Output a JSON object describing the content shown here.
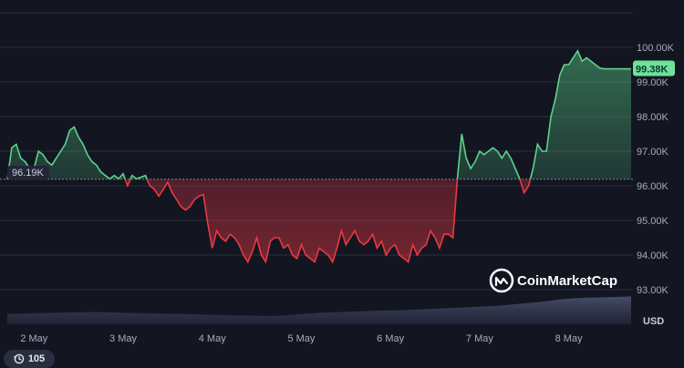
{
  "chart_data": {
    "type": "area",
    "title": "",
    "xlabel": "",
    "ylabel": "",
    "currency_label": "USD",
    "ylim": [
      92000,
      101000
    ],
    "y_ticks": [
      93000,
      94000,
      95000,
      96000,
      97000,
      98000,
      99000,
      100000
    ],
    "y_tick_labels": [
      "93.00K",
      "94.00K",
      "95.00K",
      "96.00K",
      "97.00K",
      "98.00K",
      "99.00K",
      "100.00K"
    ],
    "x_tick_labels": [
      "2 May",
      "3 May",
      "4 May",
      "5 May",
      "6 May",
      "7 May",
      "8 May"
    ],
    "x_tick_positions": [
      0.3,
      1.3,
      2.3,
      3.3,
      4.3,
      5.3,
      6.3
    ],
    "x_range": [
      0,
      7
    ],
    "baseline_value": 96190,
    "baseline_label": "96.19K",
    "current_value": 99380,
    "current_label": "99.38K",
    "colors": {
      "up": "#5bd48a",
      "down": "#ea3943",
      "badge": "#6ee19a"
    },
    "series": [
      {
        "x": [
          0,
          0.05,
          0.1,
          0.15,
          0.2,
          0.25,
          0.3,
          0.35,
          0.4,
          0.45,
          0.5,
          0.55,
          0.6,
          0.65,
          0.7,
          0.75,
          0.8,
          0.85,
          0.9,
          0.95,
          1.0,
          1.05,
          1.1,
          1.15,
          1.2,
          1.25,
          1.3,
          1.35,
          1.4,
          1.45,
          1.5,
          1.55,
          1.6,
          1.65,
          1.7,
          1.75,
          1.8,
          1.85,
          1.9,
          1.95,
          2.0,
          2.05,
          2.1,
          2.15,
          2.2,
          2.25,
          2.3,
          2.35,
          2.4,
          2.45,
          2.5,
          2.55,
          2.6,
          2.65,
          2.7,
          2.75,
          2.8,
          2.85,
          2.9,
          2.95,
          3.0,
          3.05,
          3.1,
          3.15,
          3.2,
          3.25,
          3.3,
          3.35,
          3.4,
          3.45,
          3.5,
          3.55,
          3.6,
          3.65,
          3.7,
          3.75,
          3.8,
          3.85,
          3.9,
          3.95,
          4.0,
          4.05,
          4.1,
          4.15,
          4.2,
          4.25,
          4.3,
          4.35,
          4.4,
          4.45,
          4.5,
          4.55,
          4.6,
          4.65,
          4.7,
          4.75,
          4.8,
          4.85,
          4.9,
          4.95,
          5.0,
          5.05,
          5.1,
          5.15,
          5.2,
          5.25,
          5.3,
          5.35,
          5.4,
          5.45,
          5.5,
          5.55,
          5.6,
          5.65,
          5.7,
          5.75,
          5.8,
          5.85,
          5.9,
          5.95,
          6.0,
          6.05,
          6.1,
          6.15,
          6.2,
          6.25,
          6.3,
          6.35,
          6.4,
          6.45,
          6.5,
          6.55,
          6.6,
          6.65,
          6.7,
          6.75,
          6.8,
          6.85,
          6.9,
          6.95,
          7.0
        ],
        "y": [
          96190,
          97100,
          97200,
          96800,
          96700,
          96500,
          96500,
          97000,
          96900,
          96700,
          96600,
          96800,
          97000,
          97200,
          97600,
          97700,
          97400,
          97200,
          96900,
          96700,
          96600,
          96400,
          96300,
          96200,
          96300,
          96200,
          96350,
          96000,
          96300,
          96200,
          96250,
          96300,
          96000,
          95900,
          95700,
          95900,
          96100,
          95800,
          95600,
          95400,
          95300,
          95400,
          95600,
          95700,
          95750,
          94900,
          94200,
          94700,
          94500,
          94400,
          94600,
          94500,
          94300,
          94000,
          93800,
          94100,
          94500,
          94000,
          93800,
          94400,
          94500,
          94500,
          94200,
          94300,
          94000,
          93900,
          94300,
          94000,
          93900,
          93800,
          94200,
          94100,
          94000,
          93800,
          94200,
          94700,
          94300,
          94500,
          94700,
          94400,
          94300,
          94400,
          94600,
          94200,
          94400,
          94000,
          94200,
          94300,
          94000,
          93900,
          93800,
          94300,
          94000,
          94200,
          94300,
          94700,
          94500,
          94200,
          94600,
          94600,
          94500,
          96200,
          97500,
          96800,
          96500,
          96700,
          97000,
          96900,
          97000,
          97100,
          97000,
          96800,
          97000,
          96800,
          96500,
          96200,
          95800,
          96000,
          96500,
          97200,
          97000,
          97000,
          98000,
          98500,
          99200,
          99500,
          99500,
          99700,
          99900,
          99600,
          99700,
          99600,
          99500,
          99400,
          99380,
          99380,
          99380,
          99380,
          99380,
          99380,
          99380
        ]
      }
    ],
    "volume": {
      "x": [
        0,
        0.5,
        1.0,
        1.5,
        2.0,
        2.5,
        3.0,
        3.5,
        4.0,
        4.5,
        5.0,
        5.5,
        6.0,
        6.25,
        6.5,
        6.75,
        7.0
      ],
      "v": [
        0.25,
        0.28,
        0.3,
        0.27,
        0.25,
        0.22,
        0.2,
        0.28,
        0.32,
        0.35,
        0.4,
        0.45,
        0.55,
        0.62,
        0.65,
        0.66,
        0.68
      ]
    }
  },
  "watermark": {
    "brand": "CoinMarketCap"
  },
  "history_badge": {
    "count": "105"
  }
}
